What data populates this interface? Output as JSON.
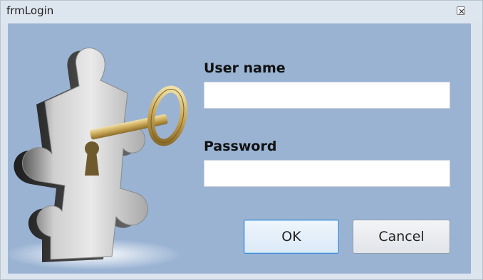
{
  "window": {
    "title": "frmLogin"
  },
  "form": {
    "username_label": "User name",
    "username_value": "",
    "password_label": "Password",
    "password_value": "",
    "ok_label": "OK",
    "cancel_label": "Cancel"
  },
  "icons": {
    "close": "close-icon",
    "art": "puzzle-key-icon"
  },
  "colors": {
    "client_background": "#9ab3d3",
    "titlebar_background": "#dde5ef",
    "ok_border": "#3c8fd6"
  }
}
